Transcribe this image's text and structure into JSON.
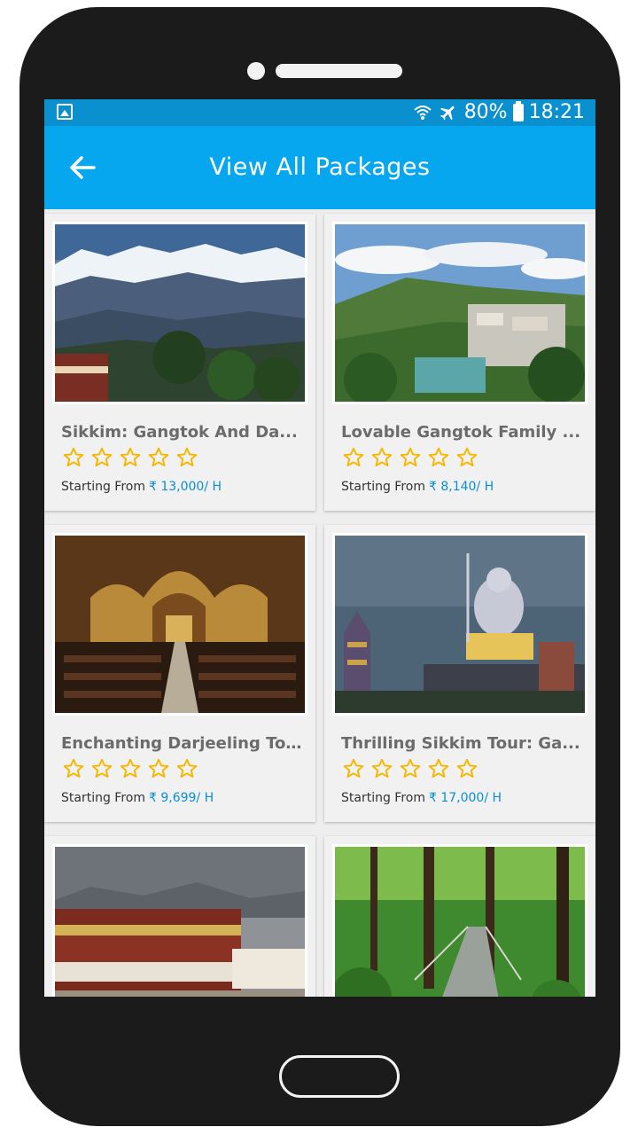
{
  "status_bar": {
    "battery": "80%",
    "time": "18:21",
    "icons": [
      "gallery-icon",
      "wifi-icon",
      "airplane-icon",
      "battery-icon"
    ]
  },
  "appbar": {
    "title": "View All Packages",
    "back_icon": "arrow-left-icon"
  },
  "colors": {
    "status_bar": "#0a8fcf",
    "app_bar": "#06a7ee",
    "price": "#0a8fcf",
    "star_outline": "#f5b800"
  },
  "packages": [
    {
      "title": "Sikkim: Gangtok And Da...",
      "starting_label": "Starting From",
      "price": "₹ 13,000/ H",
      "rating_stars": 5
    },
    {
      "title": "Lovable Gangtok Family ...",
      "starting_label": "Starting From",
      "price": "₹ 8,140/ H",
      "rating_stars": 5
    },
    {
      "title": "Enchanting Darjeeling To...",
      "starting_label": "Starting From",
      "price": "₹ 9,699/ H",
      "rating_stars": 5
    },
    {
      "title": "Thrilling Sikkim Tour: Ga...",
      "starting_label": "Starting From",
      "price": "₹ 17,000/ H",
      "rating_stars": 5
    },
    {
      "title": "",
      "starting_label": "",
      "price": ""
    },
    {
      "title": "",
      "starting_label": "",
      "price": ""
    }
  ]
}
